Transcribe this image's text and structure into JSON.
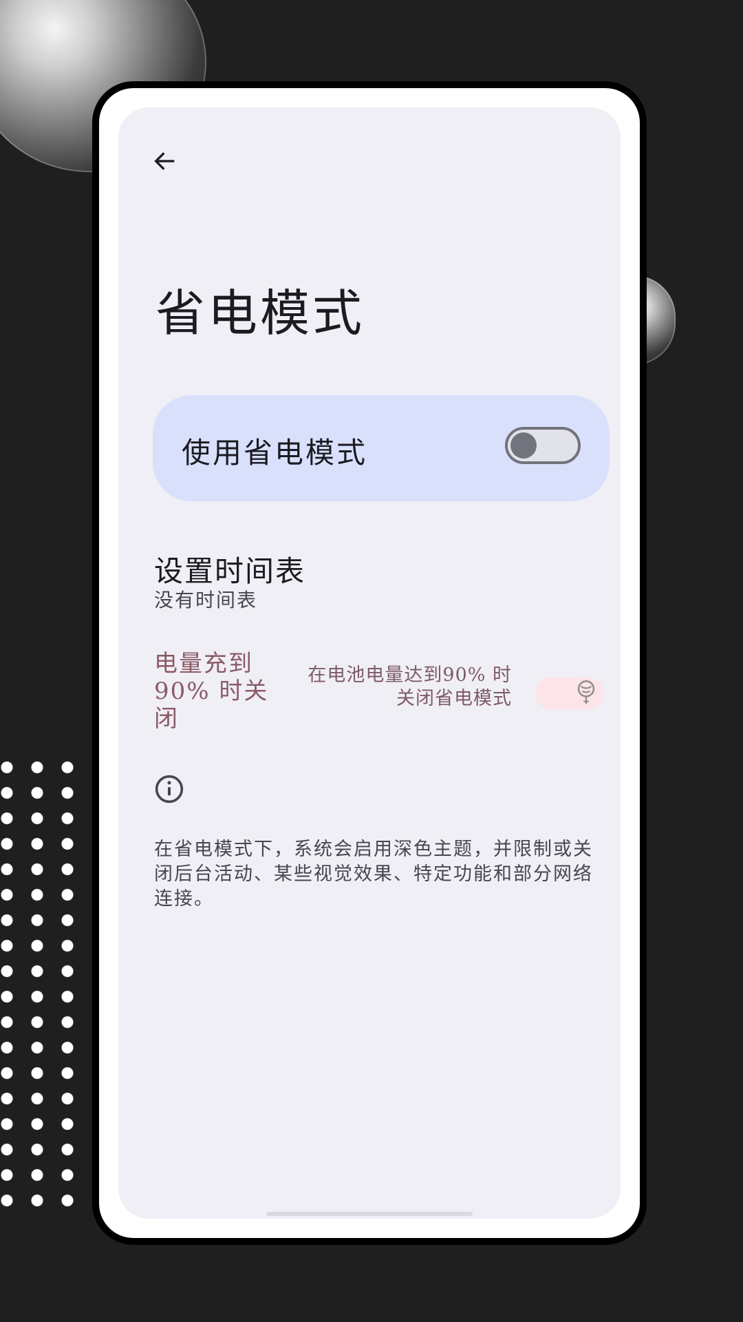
{
  "page": {
    "title": "省电模式"
  },
  "main_toggle": {
    "label": "使用省电模式",
    "state": "off"
  },
  "schedule": {
    "title": "设置时间表",
    "subtitle": "没有时间表"
  },
  "charge_off": {
    "label": "电量充到90% 时关闭",
    "description": "在电池电量达到90% 时关闭省电模式",
    "state": "disabled"
  },
  "footnote": {
    "text": "在省电模式下，系统会启用深色主题，并限制或关闭后台活动、某些视觉效果、特定功能和部分网络连接。"
  },
  "icons": {
    "back": "arrow-back-icon",
    "info": "info-icon"
  },
  "colors": {
    "background": "#1f1f1f",
    "screen": "#f0eff5",
    "card": "#d9e0fc",
    "accent_muted": "#8a5a66"
  }
}
